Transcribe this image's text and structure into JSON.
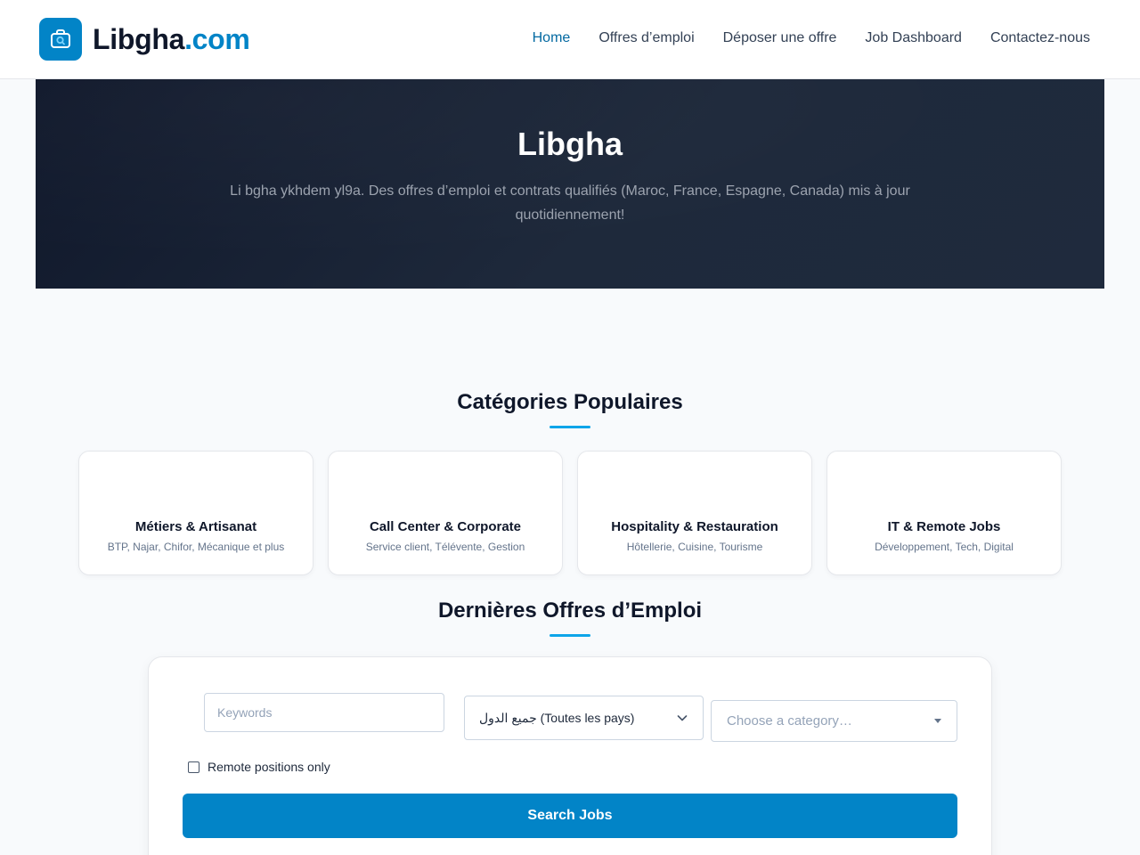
{
  "brand": {
    "name": "Libgha",
    "accent": ".com",
    "primary_color": "#0284c7",
    "icon": "briefcase-search-icon"
  },
  "nav": [
    {
      "label": "Home",
      "active": true
    },
    {
      "label": "Offres d’emploi",
      "active": false
    },
    {
      "label": "Déposer une offre",
      "active": false
    },
    {
      "label": "Job Dashboard",
      "active": false
    },
    {
      "label": "Contactez-nous",
      "active": false
    }
  ],
  "hero": {
    "title": "Libgha",
    "subtitle": "Li bgha ykhdem yl9a. Des offres d’emploi et contrats qualifiés (Maroc, France, Espagne, Canada) mis à jour quotidiennement!"
  },
  "categories": {
    "title": "Catégories Populaires",
    "items": [
      {
        "icon": "",
        "title": "Métiers & Artisanat",
        "desc": "BTP, Najar, Chifor, Mécanique et plus"
      },
      {
        "icon": "",
        "title": "Call Center & Corporate",
        "desc": "Service client, Télévente, Gestion"
      },
      {
        "icon": "",
        "title": "Hospitality & Restauration",
        "desc": "Hôtellerie, Cuisine, Tourisme"
      },
      {
        "icon": "",
        "title": "IT & Remote Jobs",
        "desc": "Développement, Tech, Digital"
      }
    ]
  },
  "jobs": {
    "title": "Dernières Offres d’Emploi",
    "keywords_placeholder": "Keywords",
    "country_value": "جميع الدول (Toutes les pays)",
    "category_placeholder": "Choose a category…",
    "remote_label": "Remote positions only",
    "search_label": "Search Jobs"
  }
}
